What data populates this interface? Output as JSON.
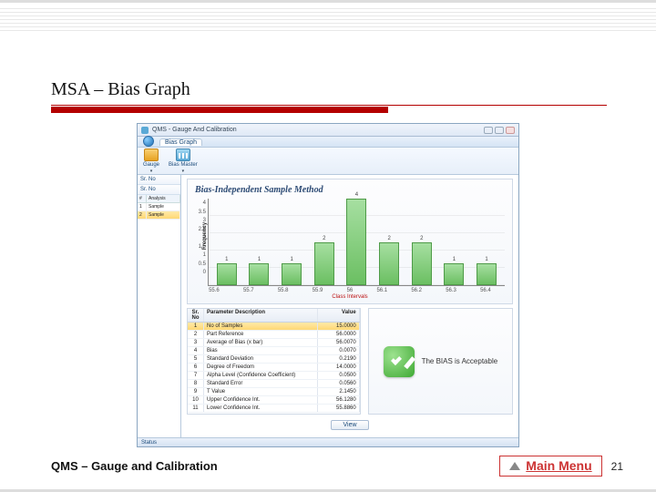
{
  "slide": {
    "title": "MSA – Bias Graph",
    "footer_left": "QMS – Gauge and Calibration",
    "main_menu_label": "Main Menu",
    "page_number": "21"
  },
  "app": {
    "window_title": "QMS - Gauge And Calibration",
    "ribbon_tab": "Bias Graph",
    "tool_gauge": "Gauge",
    "tool_bias": "Bias Master",
    "sidebar": {
      "tabs": [
        "Sr. No",
        "Sr. No"
      ],
      "grid_headers": [
        "#",
        "Analysis"
      ],
      "rows": [
        {
          "n": "1",
          "v": "Sample"
        },
        {
          "n": "2",
          "v": "Sample"
        }
      ],
      "selected_index": 1
    },
    "status": "Status"
  },
  "chart_data": {
    "type": "bar",
    "title": "Bias-Independent Sample Method",
    "xlabel": "Class Intervals",
    "ylabel": "Frequency",
    "ylim": [
      0,
      4
    ],
    "yticks": [
      0,
      0.5,
      1,
      1.5,
      2,
      2.5,
      3,
      3.5,
      4
    ],
    "categories": [
      "55.6",
      "55.7",
      "55.8",
      "55.9",
      "56",
      "56.1",
      "56.2",
      "56.3",
      "56.4"
    ],
    "values": [
      1,
      1,
      1,
      2,
      4,
      2,
      2,
      1,
      1
    ]
  },
  "params": {
    "headers": {
      "sr": "Sr. No",
      "desc": "Parameter Description",
      "val": "Value"
    },
    "rows": [
      {
        "sr": "1",
        "desc": "No of Samples",
        "val": "15.0000",
        "hl": true
      },
      {
        "sr": "2",
        "desc": "Part Reference",
        "val": "56.0000"
      },
      {
        "sr": "3",
        "desc": "Average of Bias (x bar)",
        "val": "56.0070"
      },
      {
        "sr": "4",
        "desc": "Bias",
        "val": "0.0070"
      },
      {
        "sr": "5",
        "desc": "Standard Deviation",
        "val": "0.2190"
      },
      {
        "sr": "6",
        "desc": "Degree of Freedom",
        "val": "14.0000"
      },
      {
        "sr": "7",
        "desc": "Alpha Level (Confidence Coefficient)",
        "val": "0.0500"
      },
      {
        "sr": "8",
        "desc": "Standard Error",
        "val": "0.0560"
      },
      {
        "sr": "9",
        "desc": "T Value",
        "val": "2.1450"
      },
      {
        "sr": "10",
        "desc": "Upper Confidence Int.",
        "val": "56.1280"
      },
      {
        "sr": "11",
        "desc": "Lower Confidence Int.",
        "val": "55.8860"
      }
    ]
  },
  "verdict": {
    "text": "The BIAS is Acceptable"
  },
  "action_button": "View"
}
